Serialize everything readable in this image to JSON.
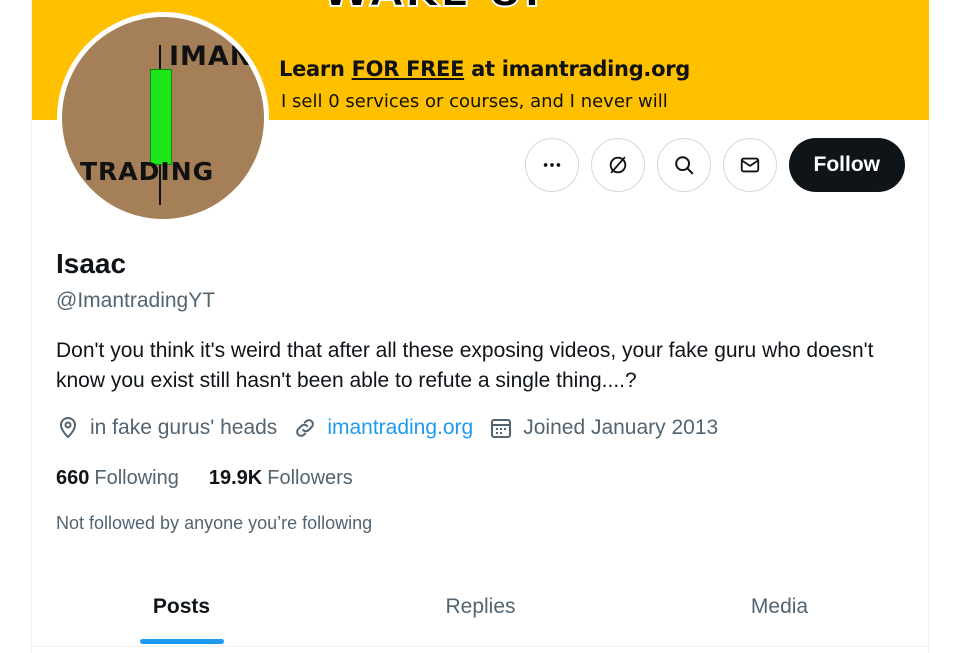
{
  "banner": {
    "headline": "WAKE UP",
    "line1_prefix": "Learn ",
    "line1_emphasis": "FOR FREE",
    "line1_suffix": " at imantrading.org",
    "line2": "I sell 0 services or courses, and I never will",
    "background_color": "#ffc000"
  },
  "avatar": {
    "text_top": "IMAN",
    "text_bottom": "TRADING",
    "candle_color": "#1ee61b",
    "background_color": "#a47f57"
  },
  "actions": {
    "more_icon": "more-horizontal-icon",
    "grok_icon": "grok-icon",
    "search_icon": "search-icon",
    "message_icon": "envelope-icon",
    "follow_label": "Follow"
  },
  "profile": {
    "display_name": "Isaac",
    "handle": "@ImantradingYT",
    "bio": "Don't you think it's weird that after all these exposing videos, your fake guru who doesn't know you exist still hasn't been able to refute a single thing....?",
    "location": "in fake gurus' heads",
    "website": "imantrading.org",
    "joined": "Joined January 2013",
    "link_color": "#1d9bf0"
  },
  "stats": {
    "following_count": "660",
    "following_label": "Following",
    "followers_count": "19.9K",
    "followers_label": "Followers"
  },
  "not_followed_text": "Not followed by anyone you’re following",
  "tabs": [
    {
      "label": "Posts",
      "active": true
    },
    {
      "label": "Replies",
      "active": false
    },
    {
      "label": "Media",
      "active": false
    }
  ]
}
